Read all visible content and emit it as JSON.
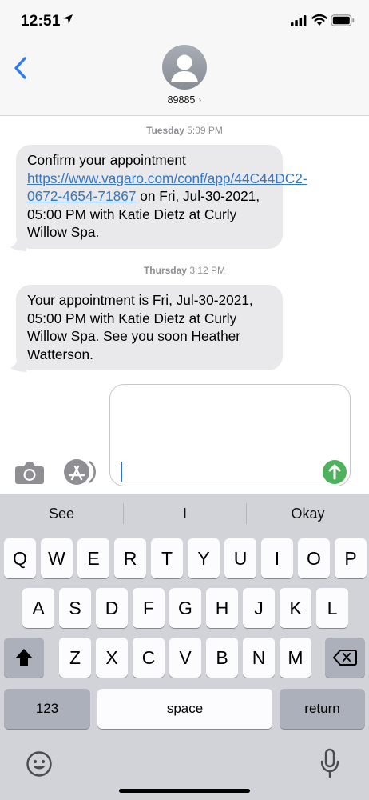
{
  "status": {
    "time": "12:51"
  },
  "header": {
    "contact": "89885"
  },
  "messages": [
    {
      "timestamp_day": "Tuesday",
      "timestamp_time": "5:09 PM",
      "pre": "Confirm your appointment ",
      "link": "https://www.vagaro.com/conf/app/44C44DC2-0672-4654-71867",
      "post": " on Fri, Jul-30-2021, 05:00 PM  with Katie Dietz at Curly Willow Spa."
    },
    {
      "timestamp_day": "Thursday",
      "timestamp_time": "3:12 PM",
      "text": "Your appointment is Fri, Jul-30-2021, 05:00 PM  with Katie Dietz at Curly Willow Spa. See you soon Heather Watterson."
    }
  ],
  "keyboard": {
    "suggestions": [
      "See",
      "I",
      "Okay"
    ],
    "row1": [
      "Q",
      "W",
      "E",
      "R",
      "T",
      "Y",
      "U",
      "I",
      "O",
      "P"
    ],
    "row2": [
      "A",
      "S",
      "D",
      "F",
      "G",
      "H",
      "J",
      "K",
      "L"
    ],
    "row3": [
      "Z",
      "X",
      "C",
      "V",
      "B",
      "N",
      "M"
    ],
    "numbers_label": "123",
    "space_label": "space",
    "return_label": "return"
  },
  "icons": {
    "back": "chevron-left-icon",
    "avatar": "person-icon",
    "camera": "camera-icon",
    "apps": "app-store-icon",
    "send": "send-arrow-up-icon",
    "shift": "shift-icon",
    "delete": "backspace-icon",
    "emoji": "emoji-icon",
    "mic": "microphone-icon"
  },
  "colors": {
    "link": "#3478c6",
    "send": "#4cb35c",
    "bubble": "#e9e9eb",
    "accent": "#2f7bf6"
  }
}
